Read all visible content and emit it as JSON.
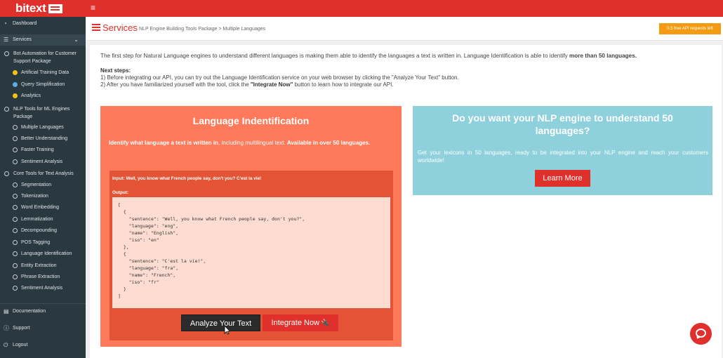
{
  "topbar": {
    "logo": "bitext",
    "menu_icon": "≡"
  },
  "sidebar": {
    "dashboard": "Dashboard",
    "services": "Services",
    "packages": [
      {
        "label": "Bot Automation for Customer Support Package",
        "items": [
          {
            "label": "Artificial Training Data",
            "color": "#f1c40f"
          },
          {
            "label": "Query Simplification",
            "color": "#5dade2"
          },
          {
            "label": "Analytics",
            "color": "#f1c40f"
          }
        ]
      },
      {
        "label": "NLP Tools for ML Engines Package",
        "items": [
          {
            "label": "Multiple Languages"
          },
          {
            "label": "Better Understanding"
          },
          {
            "label": "Faster Training"
          },
          {
            "label": "Sentiment Analysis"
          }
        ]
      },
      {
        "label": "Core Tools for Text Analysis",
        "items": [
          {
            "label": "Segmentation"
          },
          {
            "label": "Tokenization"
          },
          {
            "label": "Word Embedding"
          },
          {
            "label": "Lemmatization"
          },
          {
            "label": "Decompounding"
          },
          {
            "label": "POS Tagging"
          },
          {
            "label": "Language Identification"
          },
          {
            "label": "Entity Extraction"
          },
          {
            "label": "Phrase Extraction"
          },
          {
            "label": "Sentiment Analysis"
          }
        ]
      }
    ],
    "documentation": "Documentation",
    "support": "Support",
    "logout": "Logout"
  },
  "header": {
    "title": "Services",
    "breadcrumb": "NLP Engine Building Tools Package > Multiple Languages",
    "api_badge": "0.5 free API requests left"
  },
  "main": {
    "intro_text": "The first step for Natural Language engines to understand different languages is making them able to identify the languages a text is written in. Language Identification is able to identify ",
    "intro_bold": "more than 50 languages.",
    "next_steps_title": "Next steps:",
    "step1": "1) Before integrating our API, you can try out the Language Identification service on your web browser by clicking the \"Analyze Your Text\" button.",
    "step2_pre": "2) After you have familiarized yourself with the tool, click the ",
    "step2_bold": "\"Integrate Now\"",
    "step2_post": " button to learn how to integrate our API."
  },
  "lang_card": {
    "title": "Language Indentification",
    "desc_bold1": "Identify what language a text is written in",
    "desc_mid": ", including multilingual text. ",
    "desc_bold2": "Available in over 50 languages.",
    "input_label": "Input: Well, you know what French people say, don't you? C'est la vie!",
    "output_label": "Output:",
    "output_code": "[\n  {\n    \"sentence\": \"Well, you know what French people say, don't you?\",\n    \"language\": \"eng\",\n    \"name\": \"English\",\n    \"iso\": \"en\"\n  },\n  {\n    \"sentence\": \"C'est la vie!\",\n    \"language\": \"fra\",\n    \"name\": \"French\",\n    \"iso\": \"fr\"\n  }\n]",
    "analyze_button": "Analyze Your Text",
    "integrate_button": "Integrate Now"
  },
  "nlp_card": {
    "title": "Do you want your NLP engine to understand 50 languages?",
    "desc": "Get your lexicons in 50 languages, ready to be integrated into your NLP engine and reach your customers worldwide!",
    "learn_button": "Learn More"
  },
  "colors": {
    "brand_red": "#e0302b",
    "sidebar_bg": "#2a3840",
    "lang_card_bg": "#ff7a5a",
    "nlp_card_bg": "#8ed1dc",
    "api_badge_bg": "#f39c12"
  }
}
